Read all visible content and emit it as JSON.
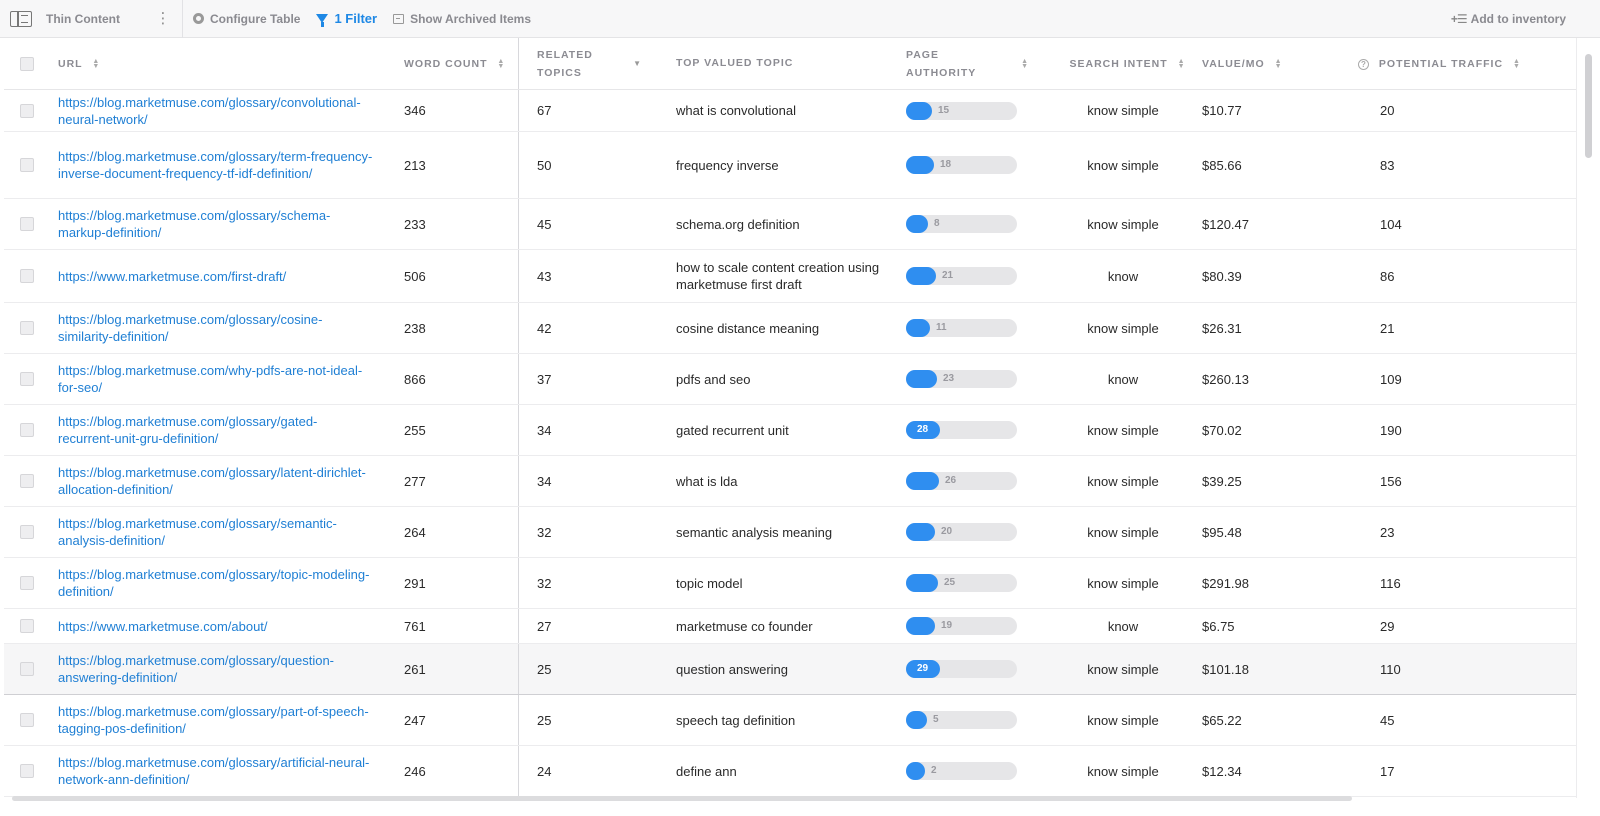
{
  "toolbar": {
    "title": "Thin Content",
    "configure_label": "Configure Table",
    "filter_label": "1 Filter",
    "archived_label": "Show Archived Items",
    "add_inventory_label": "Add to inventory"
  },
  "columns": {
    "url": "URL",
    "word_count": "WORD COUNT",
    "related_topics_1": "RELATED",
    "related_topics_2": "TOPICS",
    "top_valued_topic": "TOP VALUED TOPIC",
    "page_authority_1": "PAGE",
    "page_authority_2": "AUTHORITY",
    "search_intent": "SEARCH INTENT",
    "value_mo": "VALUE/MO",
    "potential_traffic": "POTENTIAL TRAFFIC"
  },
  "colors": {
    "link": "#1f7fd4",
    "accent": "#1e88e5",
    "bar_fill": "#2f8ef0",
    "bar_track": "#e6e6e8"
  },
  "rows": [
    {
      "url": "https://blog.marketmuse.com/glossary/convolutional-neural-network/",
      "word_count": "346",
      "related_topics": "67",
      "top_topic": "what is convolutional",
      "page_authority": 15,
      "page_authority_label": "15",
      "search_intent": "know simple",
      "value_mo": "$10.77",
      "potential_traffic": "20"
    },
    {
      "url": "https://blog.marketmuse.com/glossary/term-frequency-inverse-document-frequency-tf-idf-definition/",
      "word_count": "213",
      "related_topics": "50",
      "top_topic": "frequency inverse",
      "page_authority": 18,
      "page_authority_label": "18",
      "search_intent": "know simple",
      "value_mo": "$85.66",
      "potential_traffic": "83"
    },
    {
      "url": "https://blog.marketmuse.com/glossary/schema-markup-definition/",
      "word_count": "233",
      "related_topics": "45",
      "top_topic": "schema.org definition",
      "page_authority": 8,
      "page_authority_label": "8",
      "search_intent": "know simple",
      "value_mo": "$120.47",
      "potential_traffic": "104"
    },
    {
      "url": "https://www.marketmuse.com/first-draft/",
      "word_count": "506",
      "related_topics": "43",
      "top_topic": "how to scale content creation using marketmuse first draft",
      "page_authority": 21,
      "page_authority_label": "21",
      "search_intent": "know",
      "value_mo": "$80.39",
      "potential_traffic": "86"
    },
    {
      "url": "https://blog.marketmuse.com/glossary/cosine-similarity-definition/",
      "word_count": "238",
      "related_topics": "42",
      "top_topic": "cosine distance meaning",
      "page_authority": 11,
      "page_authority_label": "11",
      "search_intent": "know simple",
      "value_mo": "$26.31",
      "potential_traffic": "21"
    },
    {
      "url": "https://blog.marketmuse.com/why-pdfs-are-not-ideal-for-seo/",
      "word_count": "866",
      "related_topics": "37",
      "top_topic": "pdfs and seo",
      "page_authority": 23,
      "page_authority_label": "23",
      "search_intent": "know",
      "value_mo": "$260.13",
      "potential_traffic": "109"
    },
    {
      "url": "https://blog.marketmuse.com/glossary/gated-recurrent-unit-gru-definition/",
      "word_count": "255",
      "related_topics": "34",
      "top_topic": "gated recurrent unit",
      "page_authority": 28,
      "page_authority_label": "28",
      "search_intent": "know simple",
      "value_mo": "$70.02",
      "potential_traffic": "190"
    },
    {
      "url": "https://blog.marketmuse.com/glossary/latent-dirichlet-allocation-definition/",
      "word_count": "277",
      "related_topics": "34",
      "top_topic": "what is lda",
      "page_authority": 26,
      "page_authority_label": "26",
      "search_intent": "know simple",
      "value_mo": "$39.25",
      "potential_traffic": "156"
    },
    {
      "url": "https://blog.marketmuse.com/glossary/semantic-analysis-definition/",
      "word_count": "264",
      "related_topics": "32",
      "top_topic": "semantic analysis meaning",
      "page_authority": 20,
      "page_authority_label": "20",
      "search_intent": "know simple",
      "value_mo": "$95.48",
      "potential_traffic": "23"
    },
    {
      "url": "https://blog.marketmuse.com/glossary/topic-modeling-definition/",
      "word_count": "291",
      "related_topics": "32",
      "top_topic": "topic model",
      "page_authority": 25,
      "page_authority_label": "25",
      "search_intent": "know simple",
      "value_mo": "$291.98",
      "potential_traffic": "116"
    },
    {
      "url": "https://www.marketmuse.com/about/",
      "word_count": "761",
      "related_topics": "27",
      "top_topic": "marketmuse co founder",
      "page_authority": 19,
      "page_authority_label": "19",
      "search_intent": "know",
      "value_mo": "$6.75",
      "potential_traffic": "29"
    },
    {
      "url": "https://blog.marketmuse.com/glossary/question-answering-definition/",
      "word_count": "261",
      "related_topics": "25",
      "top_topic": "question answering",
      "page_authority": 29,
      "page_authority_label": "29",
      "search_intent": "know simple",
      "value_mo": "$101.18",
      "potential_traffic": "110"
    },
    {
      "url": "https://blog.marketmuse.com/glossary/part-of-speech-tagging-pos-definition/",
      "word_count": "247",
      "related_topics": "25",
      "top_topic": "speech tag definition",
      "page_authority": 5,
      "page_authority_label": "5",
      "search_intent": "know simple",
      "value_mo": "$65.22",
      "potential_traffic": "45"
    },
    {
      "url": "https://blog.marketmuse.com/glossary/artificial-neural-network-ann-definition/",
      "word_count": "246",
      "related_topics": "24",
      "top_topic": "define ann",
      "page_authority": 2,
      "page_authority_label": "2",
      "search_intent": "know simple",
      "value_mo": "$12.34",
      "potential_traffic": "17"
    }
  ]
}
